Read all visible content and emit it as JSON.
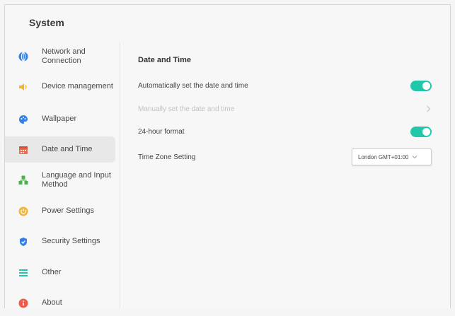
{
  "app_title": "System",
  "sidebar": {
    "items": [
      {
        "label": "Network and Connection",
        "icon": "globe-icon",
        "color": "#2f80ed"
      },
      {
        "label": "Device management",
        "icon": "speaker-icon",
        "color": "#f2b53a"
      },
      {
        "label": "Wallpaper",
        "icon": "palette-icon",
        "color": "#2f80ed"
      },
      {
        "label": "Date and Time",
        "icon": "calendar-icon",
        "color": "#ef6a4a",
        "active": true
      },
      {
        "label": "Language and Input Method",
        "icon": "language-icon",
        "color": "#4caf50"
      },
      {
        "label": "Power Settings",
        "icon": "power-icon",
        "color": "#f2b53a"
      },
      {
        "label": "Security Settings",
        "icon": "shield-icon",
        "color": "#2f80ed"
      },
      {
        "label": "Other",
        "icon": "list-icon",
        "color": "#22c7a9"
      },
      {
        "label": "About",
        "icon": "info-icon",
        "color": "#ef5b4a"
      }
    ]
  },
  "main": {
    "section_title": "Date and Time",
    "rows": {
      "auto_datetime": {
        "label": "Automatically set the date and time",
        "enabled": true
      },
      "manual_datetime": {
        "label": "Manually set the date and time",
        "disabled": true
      },
      "hour24": {
        "label": "24-hour format",
        "enabled": true
      },
      "timezone": {
        "label": "Time Zone Setting",
        "value": "London GMT+01:00"
      }
    }
  },
  "colors": {
    "accent": "#22c7a9"
  }
}
